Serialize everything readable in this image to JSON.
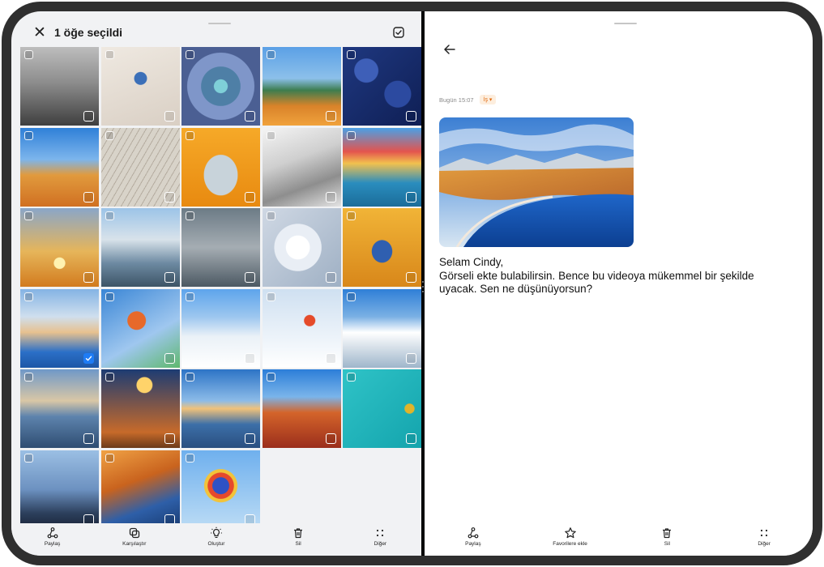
{
  "gallery": {
    "selection_title": "1 öğe seçildi",
    "photos": [
      {
        "subject": "misty-mountain-sunrays"
      },
      {
        "subject": "skateboarder-jump"
      },
      {
        "subject": "succulent-plant"
      },
      {
        "subject": "camping-lake-view"
      },
      {
        "subject": "blueberries"
      },
      {
        "subject": "desert-rock"
      },
      {
        "subject": "leaf-veins"
      },
      {
        "subject": "tent-interior"
      },
      {
        "subject": "abstract-architecture"
      },
      {
        "subject": "colorful-canal-houses"
      },
      {
        "subject": "golden-sunset-clouds"
      },
      {
        "subject": "cliff-jumper-sea"
      },
      {
        "subject": "fisherman-net"
      },
      {
        "subject": "dandelion-seeds"
      },
      {
        "subject": "woman-autumn-leaves"
      },
      {
        "subject": "salt-lake-shore",
        "selected": true
      },
      {
        "subject": "snowboarder"
      },
      {
        "subject": "snowy-forest"
      },
      {
        "subject": "skier-downhill"
      },
      {
        "subject": "snowy-mountains"
      },
      {
        "subject": "pier-at-dusk"
      },
      {
        "subject": "lamp-on-table"
      },
      {
        "subject": "sunset-road"
      },
      {
        "subject": "chinese-temple-roof"
      },
      {
        "subject": "turquoise-water-kayak"
      },
      {
        "subject": "dusky-mountain-ridge"
      },
      {
        "subject": "bridge-at-sunset"
      },
      {
        "subject": "hot-air-balloon"
      }
    ],
    "toolbar": [
      {
        "label": "Paylaş",
        "icon": "share-icon"
      },
      {
        "label": "Karşılaştır",
        "icon": "compare-icon"
      },
      {
        "label": "Oluştur",
        "icon": "create-icon"
      },
      {
        "label": "Sil",
        "icon": "delete-icon"
      },
      {
        "label": "Diğer",
        "icon": "more-icon"
      }
    ]
  },
  "note": {
    "date": "Bugün 15:07",
    "tag": "İş ▾",
    "greeting": "Selam Cindy,",
    "body_line1": "Görseli ekte bulabilirsin. Bence bu videoya mükemmel bir şekilde",
    "body_line2": "uyacak. Sen ne düşünüyorsun?",
    "toolbar": [
      {
        "label": "Paylaş",
        "icon": "share-icon"
      },
      {
        "label": "Favorilere ekle",
        "icon": "star-icon"
      },
      {
        "label": "Sil",
        "icon": "delete-icon"
      },
      {
        "label": "Diğer",
        "icon": "more-icon"
      }
    ]
  },
  "colors": {
    "accent": "#1e7cf5",
    "tag_text": "#e06a10",
    "tag_bg": "#fdeede",
    "bezel": "#2f2f2f"
  }
}
